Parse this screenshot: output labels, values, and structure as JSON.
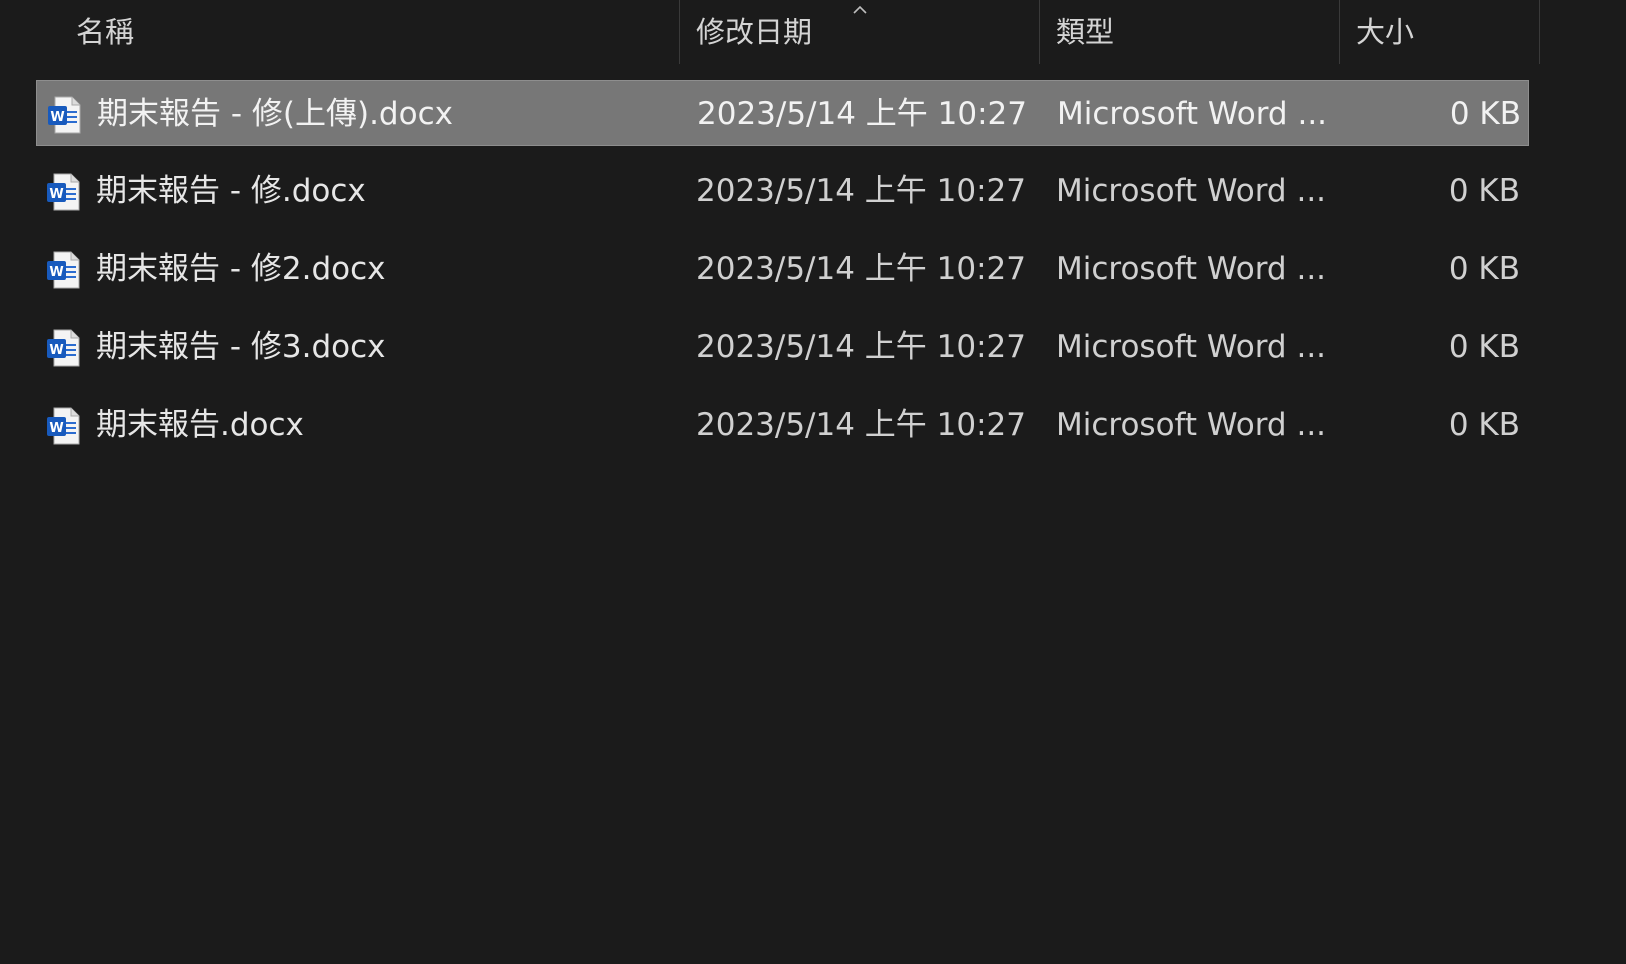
{
  "header": {
    "name_label": "名稱",
    "date_label": "修改日期",
    "type_label": "類型",
    "size_label": "大小",
    "sort_indicator_icon": "sort-ascending-chevron-icon"
  },
  "colors": {
    "background": "#1b1b1b",
    "selected_row": "#777777",
    "word_blue": "#185abd"
  },
  "files": [
    {
      "name": "期末報告 - 修(上傳).docx",
      "date": "2023/5/14 上午 10:27",
      "type": "Microsoft Word ...",
      "size": "0 KB",
      "icon": "word-document-icon",
      "selected": true
    },
    {
      "name": "期末報告 - 修.docx",
      "date": "2023/5/14 上午 10:27",
      "type": "Microsoft Word ...",
      "size": "0 KB",
      "icon": "word-document-icon",
      "selected": false
    },
    {
      "name": "期末報告 - 修2.docx",
      "date": "2023/5/14 上午 10:27",
      "type": "Microsoft Word ...",
      "size": "0 KB",
      "icon": "word-document-icon",
      "selected": false
    },
    {
      "name": "期末報告 - 修3.docx",
      "date": "2023/5/14 上午 10:27",
      "type": "Microsoft Word ...",
      "size": "0 KB",
      "icon": "word-document-icon",
      "selected": false
    },
    {
      "name": "期末報告.docx",
      "date": "2023/5/14 上午 10:27",
      "type": "Microsoft Word ...",
      "size": "0 KB",
      "icon": "word-document-icon",
      "selected": false
    }
  ]
}
